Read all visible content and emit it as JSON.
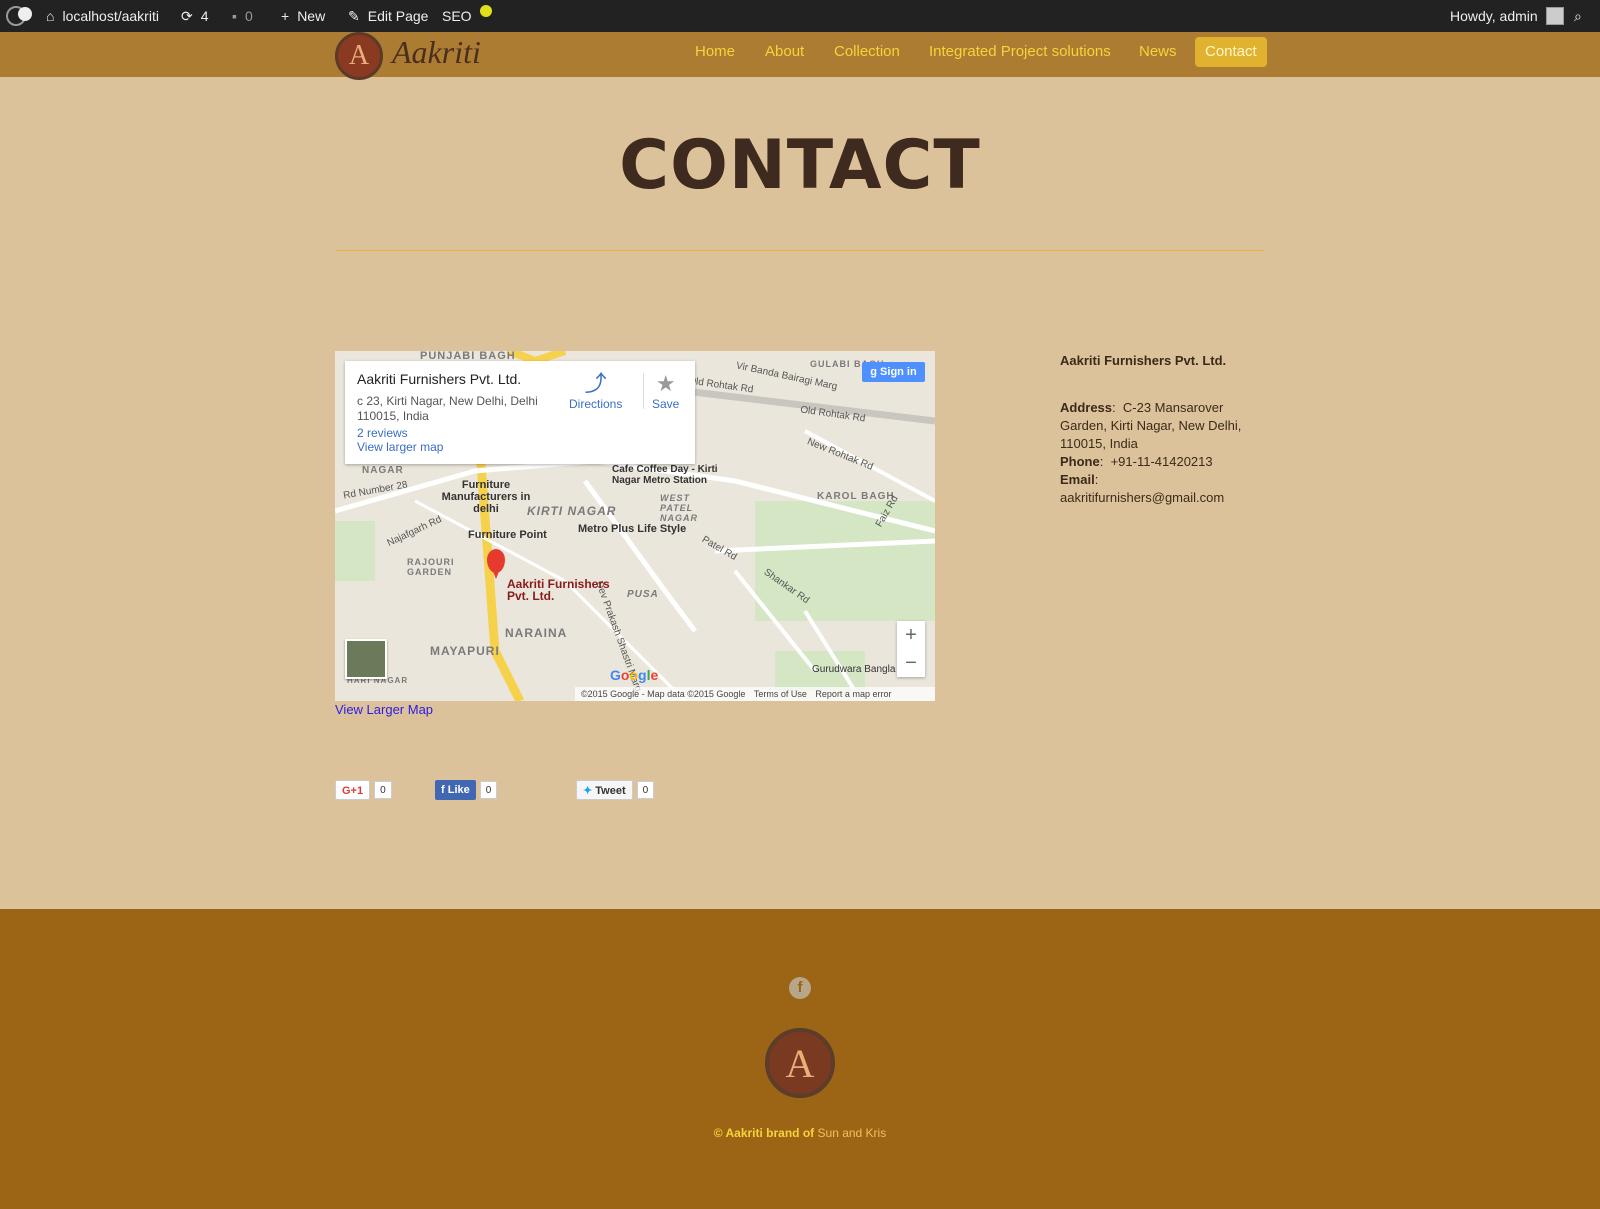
{
  "adminbar": {
    "site": "localhost/aakriti",
    "updates_count": "4",
    "comments_count": "0",
    "new_label": "New",
    "edit_label": "Edit Page",
    "seo_label": "SEO",
    "howdy": "Howdy, admin"
  },
  "header": {
    "logo_letter": "A",
    "logo_text": "Aakriti",
    "nav": [
      "Home",
      "About",
      "Collection",
      "Integrated Project solutions",
      "News",
      "Contact"
    ],
    "active": "Contact"
  },
  "page": {
    "title": "CONTACT"
  },
  "map": {
    "card_name": "Aakriti Furnishers Pvt. Ltd.",
    "card_address": "c 23, Kirti Nagar, New Delhi, Delhi 110015, India",
    "reviews": "2 reviews",
    "view_larger_inline": "View larger map",
    "directions": "Directions",
    "save": "Save",
    "signin": "Sign in",
    "pin_label": "Aakriti Furnishers Pvt. Ltd.",
    "google": "Google",
    "attribution": "©2015 Google - Map data ©2015 Google",
    "terms": "Terms of Use",
    "report": "Report a map error",
    "labels": {
      "punjabi_bagh": "PUNJABI BAGH",
      "gulabi_bagh": "GULABI BAGH",
      "vir_banda": "Vir Banda Bairagi Marg",
      "old_rohtak": "Old Rohtak Rd",
      "old_rohtak_2": "Old Rohtak Rd",
      "new_rohtak": "New Rohtak Rd",
      "nagar": "NAGAR",
      "rd_number": "Rd Number 28",
      "furniture_mfr": "Furniture Manufacturers in delhi",
      "kirti_nagar": "KIRTI NAGAR",
      "cafe": "Cafe Coffee Day - Kirti Nagar Metro Station",
      "west_patel": "WEST PATEL NAGAR",
      "karol_bagh": "KAROL BAGH",
      "najafgarh": "Najafgarh Rd",
      "furniture_point": "Furniture Point",
      "metro_plus": "Metro Plus Life Style",
      "rajouri": "RAJOURI GARDEN",
      "patel_rd": "Patel Rd",
      "shankar_rd": "Shankar Rd",
      "faiz_rd": "Faiz Rd",
      "pusa": "PUSA",
      "naraina": "NARAINA",
      "dev_prakash": "Dev Prakash Shastri Marg",
      "mayapuri": "MAYAPURI",
      "gurudwara": "Gurudwara Bangla Sahib",
      "hari_nagar": "HARI NAGAR"
    }
  },
  "view_larger_map": "View Larger Map",
  "share": {
    "gplus": "G+1",
    "gplus_count": "0",
    "fb": "Like",
    "fb_count": "0",
    "tweet": "Tweet",
    "tweet_count": "0"
  },
  "contact": {
    "company": "Aakriti Furnishers Pvt. Ltd.",
    "address_label": "Address",
    "address": "C-23 Mansarover Garden, Kirti Nagar, New Delhi, 110015, India",
    "phone_label": "Phone",
    "phone": "+91-11-41420213",
    "email_label": "Email",
    "email": "aakritifurnishers@gmail.com"
  },
  "footer": {
    "logo_letter": "A",
    "copyright_prefix": "© Aakriti brand of",
    "brand_link": "Sun and Kris"
  },
  "colors": {
    "header_bg": "#ad7c33",
    "page_bg": "#dcc29a",
    "footer_bg": "#9c6516",
    "nav_text": "#f6d33a",
    "nav_active_bg": "#e0b22f"
  }
}
